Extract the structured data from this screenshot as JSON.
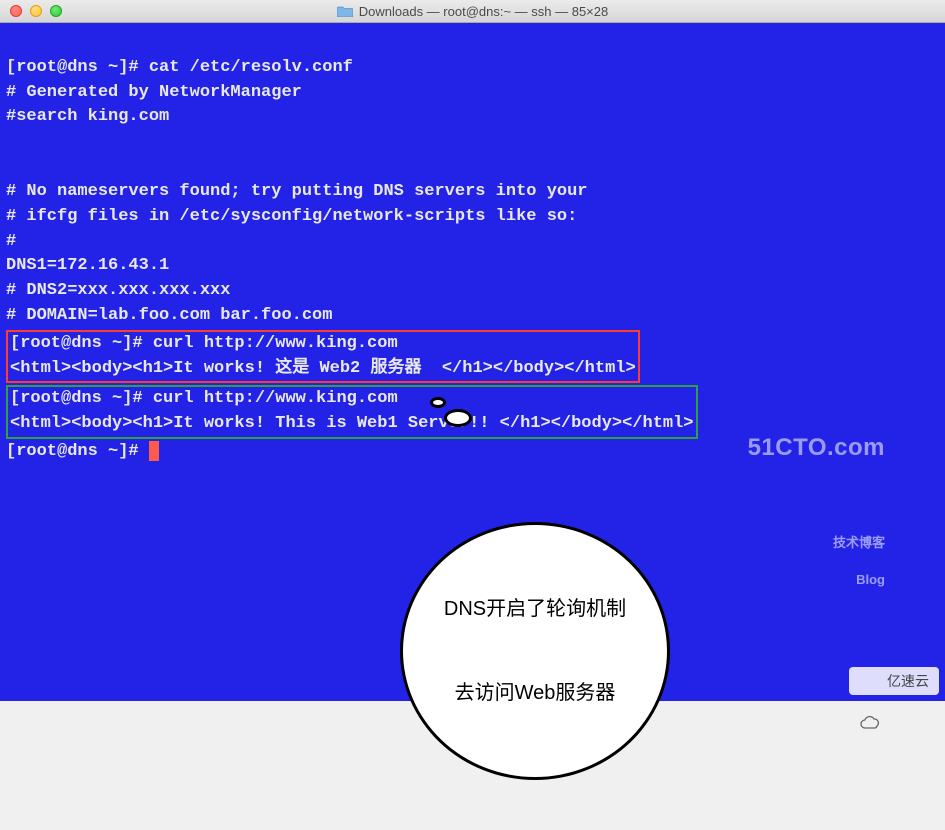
{
  "window": {
    "title": "Downloads — root@dns:~ — ssh — 85×28"
  },
  "terminal": {
    "lines": {
      "l1": "[root@dns ~]# cat /etc/resolv.conf",
      "l2": "# Generated by NetworkManager",
      "l3": "#search king.com",
      "l4": "",
      "l5": "",
      "l6": "# No nameservers found; try putting DNS servers into your",
      "l7": "# ifcfg files in /etc/sysconfig/network-scripts like so:",
      "l8": "#",
      "l9": "DNS1=172.16.43.1",
      "l10": "# DNS2=xxx.xxx.xxx.xxx",
      "l11": "# DOMAIN=lab.foo.com bar.foo.com",
      "box1_l1": "[root@dns ~]# curl http://www.king.com",
      "box1_l2": "<html><body><h1>It works! 这是 Web2 服务器  </h1></body></html>",
      "box2_l1": "[root@dns ~]# curl http://www.king.com",
      "box2_l2": "<html><body><h1>It works! This is Web1 Server!! </h1></body></html>",
      "prompt": "[root@dns ~]# "
    }
  },
  "callout": {
    "line1": "DNS开启了轮询机制",
    "line2": "去访问Web服务器"
  },
  "watermarks": {
    "w1_big": "51CTO.com",
    "w1_small": "技术博客",
    "w1_badge": "Blog",
    "w2": "亿速云"
  }
}
